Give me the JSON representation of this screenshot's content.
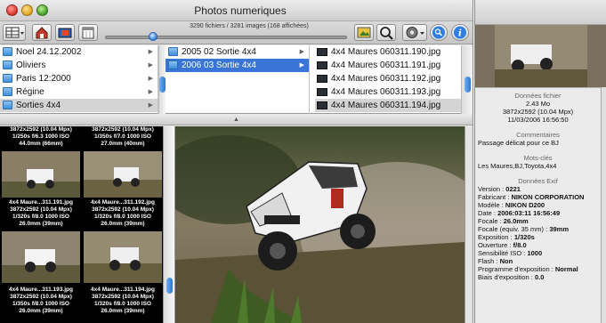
{
  "window": {
    "title": "Photos numeriques",
    "count_label": "3290 fichiers / 3281 images (168 affichées)",
    "slider_level": 0.2
  },
  "icons": [
    "view-mode-icon",
    "home-icon",
    "import-icon",
    "calendar-icon",
    "slideshow-icon",
    "zoom-icon",
    "action-gear-icon",
    "search-icon",
    "info-icon"
  ],
  "browser": {
    "folders": [
      {
        "label": "Noel 24.12.2002"
      },
      {
        "label": "Oliviers"
      },
      {
        "label": "Paris 12:2000"
      },
      {
        "label": "Régine"
      },
      {
        "label": "Sorties 4x4"
      }
    ],
    "subfolders": [
      {
        "label": "2005 02 Sortie 4x4"
      },
      {
        "label": "2006 03 Sortie 4x4"
      }
    ],
    "files": [
      {
        "label": "4x4 Maures 060311.190.jpg"
      },
      {
        "label": "4x4 Maures 060311.191.jpg"
      },
      {
        "label": "4x4 Maures 060311.192.jpg"
      },
      {
        "label": "4x4 Maures 060311.193.jpg"
      },
      {
        "label": "4x4 Maures 060311.194.jpg"
      }
    ]
  },
  "thumbnails": {
    "top_row": [
      {
        "line1": "3872x2592 (10.04 Mpx)",
        "line2": "1/250s f/6.3 1000 ISO",
        "line3": "44.0mm (66mm)"
      },
      {
        "line1": "3872x2592 (10.04 Mpx)",
        "line2": "1/350s f/7.0 1000 ISO",
        "line3": "27.0mm (40mm)"
      }
    ],
    "middle_row": [
      {
        "name": "4x4 Maure...311.191.jpg",
        "line1": "3872x2592 (10.04 Mpx)",
        "line2": "1/320s f/8.0 1000 ISO",
        "line3": "26.0mm (39mm)"
      },
      {
        "name": "4x4 Maure...311.192.jpg",
        "line1": "3872x2592 (10.04 Mpx)",
        "line2": "1/320s f/8.0 1000 ISO",
        "line3": "26.0mm (39mm)"
      }
    ],
    "bottom_row": [
      {
        "name": "4x4 Maure...311.193.jpg",
        "line1": "3872x2592 (10.04 Mpx)",
        "line2": "1/350s f/8.0 1000 ISO",
        "line3": "26.0mm (39mm)"
      },
      {
        "name": "4x4 Maure...311.194.jpg",
        "line1": "3872x2592 (10.04 Mpx)",
        "line2": "1/320s f/8.0 1000 ISO",
        "line3": "26.0mm (39mm)"
      }
    ]
  },
  "info": {
    "file_header": "Données fichier",
    "file_size": "2.43 Mo",
    "dimensions": "3872x2592 (10.04 Mpx)",
    "date": "11/03/2006 16:56:50",
    "comments_header": "Commentaires",
    "comment": "Passage délicat pour ce BJ",
    "keywords_header": "Mots-clés",
    "keywords": "Les Maures,BJ,Toyota,4x4",
    "exif_header": "Données Exif",
    "exif": [
      {
        "k": "Version : ",
        "v": "0221"
      },
      {
        "k": "Fabricant : ",
        "v": "NIKON CORPORATION"
      },
      {
        "k": "Modèle : ",
        "v": "NIKON D200"
      },
      {
        "k": "Date : ",
        "v": "2006:03:11 16:56:49"
      },
      {
        "k": "Focale : ",
        "v": "26.0mm"
      },
      {
        "k": "Focale (equiv. 35 mm) : ",
        "v": "39mm"
      },
      {
        "k": "Exposition : ",
        "v": "1/320s"
      },
      {
        "k": "Ouverture : ",
        "v": "f/8.0"
      },
      {
        "k": "Sensibilité ISO : ",
        "v": "1000"
      },
      {
        "k": "Flash : ",
        "v": "Non"
      },
      {
        "k": "Programme d'exposition : ",
        "v": "Normal"
      },
      {
        "k": "Biais d'exposition : ",
        "v": "0.0"
      }
    ]
  },
  "colors": {
    "selection": "#3875d7",
    "accent": "#2f74d0"
  }
}
